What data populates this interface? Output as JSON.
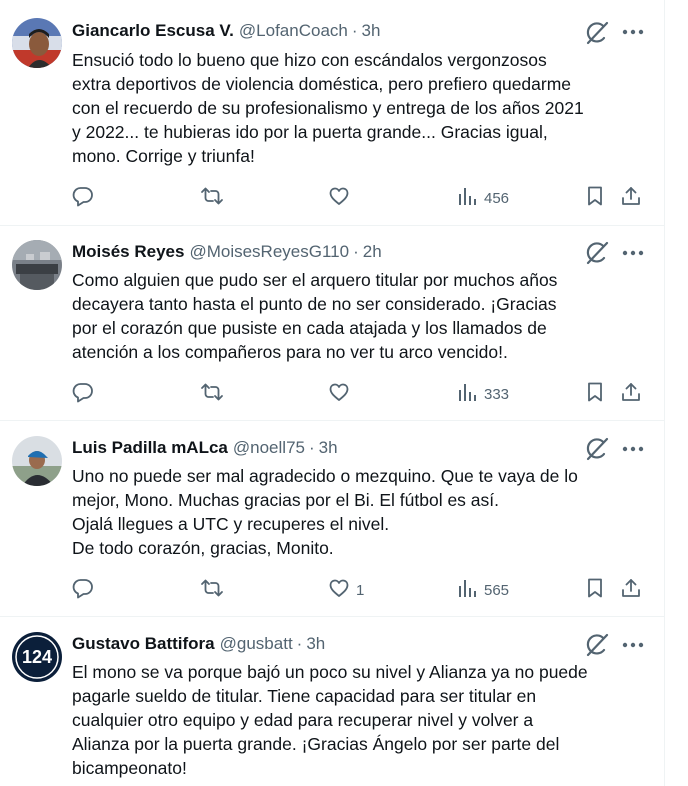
{
  "icons": {
    "grok": "grok-icon",
    "more": "more-dots-icon",
    "reply": "reply-icon",
    "retweet": "retweet-icon",
    "like": "heart-icon",
    "views": "views-chart-icon",
    "bookmark": "bookmark-icon",
    "share": "share-icon"
  },
  "colors": {
    "text": "#0f1419",
    "secondary": "#536471",
    "divider": "#eff3f4"
  },
  "tweets": [
    {
      "name": "Giancarlo Escusa V.",
      "handle": "@LofanCoach",
      "separator": "·",
      "time": "3h",
      "text": "Ensució todo lo bueno que hizo con escándalos vergonzosos\nextra deportivos de violencia doméstica, pero prefiero quedarme\ncon el recuerdo de su profesionalismo y entrega de los años 2021\ny 2022... te hubieras ido por la puerta grande... Gracias igual,\nmono. Corrige y triunfa!",
      "likes": "",
      "views": "456"
    },
    {
      "name": "Moisés Reyes",
      "handle": "@MoisesReyesG110",
      "separator": "·",
      "time": "2h",
      "text": "Como alguien que pudo ser el arquero titular por muchos años\ndecayera tanto hasta el punto de no ser considerado. ¡Gracias\npor el corazón que pusiste en cada atajada y los llamados de\natención a los compañeros para no ver tu arco vencido!.",
      "likes": "",
      "views": "333"
    },
    {
      "name": "Luis Padilla mALca",
      "handle": "@noell75",
      "separator": "·",
      "time": "3h",
      "text": "Uno no puede ser mal agradecido o mezquino. Que te vaya de lo\nmejor, Mono. Muchas gracias por el Bi. El fútbol es así.\nOjalá llegues a UTC y recuperes el nivel.\nDe todo corazón, gracias, Monito.",
      "likes": "1",
      "views": "565"
    },
    {
      "name": "Gustavo Battifora",
      "handle": "@gusbatt",
      "separator": "·",
      "time": "3h",
      "text": "El mono se va porque bajó un poco su nivel y Alianza ya no puede\npagarle sueldo de titular. Tiene capacidad para ser titular en\ncualquier otro equipo y edad para recuperar nivel y volver a\nAlianza por la puerta grande. ¡Gracias Ángelo por ser parte del\nbicampeonato!",
      "avatar_text": "124"
    }
  ]
}
